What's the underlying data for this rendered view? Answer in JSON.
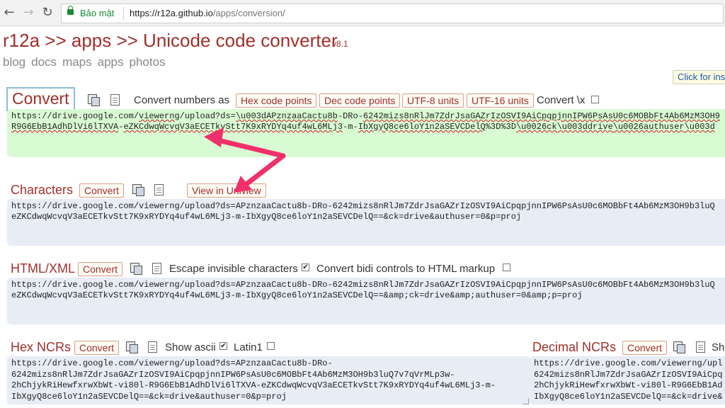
{
  "browser": {
    "secure_label": "Bảo mật",
    "url_host": "https://r12a.github.io",
    "url_path": "/apps/conversion/",
    "back": "←",
    "forward": "→",
    "reload": "↻"
  },
  "header": {
    "title": "r12a >> apps >> Unicode code converter",
    "version": "v8.1",
    "nav": [
      "blog",
      "docs",
      "maps",
      "apps",
      "photos"
    ],
    "click_for": "Click for ins"
  },
  "convert_row": {
    "convert_label": "Convert",
    "numbers_as": "Convert numbers as",
    "hex_code_points": "Hex code points",
    "dec_code_points": "Dec code points",
    "utf8": "UTF-8 units",
    "utf16": "UTF-16 units",
    "convert_x": "Convert \\x",
    "input_line1a": "https://drive.google.com/",
    "input_line1b": "viewerng",
    "input_line1c": "/upload?ds=",
    "input_line1d": "\\u003dAPznzaaCactu8b",
    "input_line1e": "-DRo-",
    "input_line1f": "6242mizs8nRlJm7ZdrJsaGAZrIzOSVI9AiCpqpjnnIPW6PsAsU0c6MOBbFt4Ab6MzM3OH9",
    "input_line2a": "R9G6EbB1AdhDlVi6lTXVA",
    "input_line2b": "-",
    "input_line2c": "eZKCdwqWcvqV3aECETkvStt7K9xRYDYq4uf4wL6MLj3",
    "input_line2d": "-m-",
    "input_line2e": "IbXgyQ8ce6loY1n2aSEVCDelQ",
    "input_line2f": "%3D%3D",
    "input_line2g": "\\u0026ck",
    "input_line2h": "\\u003ddrive",
    "input_line2i": "\\u0026authuser",
    "input_line2j": "\\u003d"
  },
  "characters": {
    "title": "Characters",
    "convert_label": "Convert",
    "view_in": "View in Uniview",
    "line1": "https://drive.google.com/viewerng/upload?ds=APznzaaCactu8b-DRo-6242mizs8nRlJm7ZdrJsaGAZrIzOSVI9AiCpqpjnnIPW6PsAsU0c6MOBbFt4Ab6MzM3OH9b3luQ",
    "line2": "eZKCdwqWcvqV3aECETkvStt7K9xRYDYq4uf4wL6MLj3-m-IbXgyQ8ce6loY1n2aSEVCDelQ==&ck=drive&authuser=0&p=proj"
  },
  "html_xml": {
    "title": "HTML/XML",
    "convert_label": "Convert",
    "escape_invisible": "Escape invisible characters",
    "convert_bidi": "Convert bidi controls to HTML markup",
    "line1": "https://drive.google.com/viewerng/upload?ds=APznzaaCactu8b-DRo-6242mizs8nRlJm7ZdrJsaGAZrIzOSVI9AiCpqpjnnIPW6PsAsU0c6MOBbFt4Ab6MzM3OH9b3luQ",
    "line2": "eZKCdwqWcvqV3aECETkvStt7K9xRYDYq4uf4wL6MLj3-m-IbXgyQ8ce6loY1n2aSEVCDelQ==&amp;ck=drive&amp;authuser=0&amp;p=proj"
  },
  "hex_ncrs": {
    "title": "Hex NCRs",
    "convert_label": "Convert",
    "show_ascii": "Show ascii",
    "latin1": "Latin1",
    "line1": "https://drive.google.com/viewerng/upload?ds=APznzaaCactu8b-DRo-",
    "line2": "6242mizs8nRlJm7ZdrJsaGAZrIzOSVI9AiCpqpjnnIPW6PsAsU0c6MOBbFt4Ab6MzM3OH9b3luQ7v7qVrMLp3w-",
    "line3": "2hChjykRiHewfxrwXbWt-vi80l-R9G6EbB1AdhDlVi6lTXVA-eZKCdwqWcvqV3aECETkvStt7K9xRYDYq4uf4wL6MLj3-m-",
    "line4": "IbXgyQ8ce6loY1n2aSEVCDelQ==&ck=drive&authuser=0&p=proj"
  },
  "decimal_ncrs": {
    "title": "Decimal NCRs",
    "convert_label": "Convert",
    "show": "Sh",
    "line1": "https://drive.google.com/viewerng/upl",
    "line2": "6242mizs8nRlJm7ZdrJsaGAZrIzOSVI9AiCpq",
    "line3": "2hChjykRiHewfxrwXbWt-vi80l-R9G6EbB1Ad",
    "line4": "IbXgyQ8ce6loY1n2aSEVCDelQ==&ck=drive&"
  },
  "checks": {
    "checked": "✔"
  },
  "colors": {
    "accent": "#a0302a",
    "arrow": "#f0306a",
    "green_box": "#d9fbd4",
    "blue_box": "#e8ecf5"
  }
}
